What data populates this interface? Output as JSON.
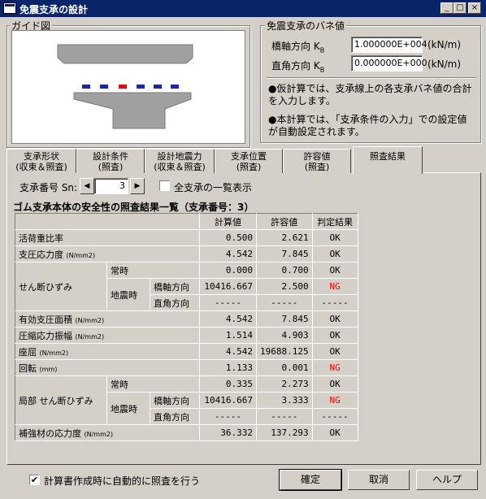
{
  "window": {
    "title": "免震支承の設計",
    "minimize": "_",
    "maximize": "□",
    "close": "×"
  },
  "guide": {
    "label": "ガイド図"
  },
  "spring": {
    "label": "免震支承のバネ値",
    "rows": [
      {
        "label": "橋軸方向 K",
        "sub": "B",
        "value": "1.000000E+004",
        "unit": "(kN/m)"
      },
      {
        "label": "直角方向 K",
        "sub": "B",
        "value": "0.000000E+000",
        "unit": "(kN/m)"
      }
    ],
    "notes": [
      "●仮計算では、支承線上の各支承バネ値の合計を入力します。",
      "●本計算では、「支承条件の入力」での設定値が自動設定されます。"
    ]
  },
  "tabs": [
    {
      "line1": "支承形状",
      "line2": "(収束＆照査)"
    },
    {
      "line1": "設計条件",
      "line2": "(照査)"
    },
    {
      "line1": "設計地震力",
      "line2": "(収束＆照査)"
    },
    {
      "line1": "支承位置",
      "line2": "(照査)"
    },
    {
      "line1": "許容値",
      "line2": "(照査)"
    },
    {
      "line1": "照査結果",
      "line2": ""
    }
  ],
  "selector": {
    "label": "支承番号 Sn:",
    "prev": "◀",
    "value": "3",
    "next": "▶",
    "all_checkbox_label": "全支承の一覧表示",
    "all_checked": false
  },
  "table": {
    "heading": "ゴム支承本体の安全性の照査結果一覧（支承番号：3）",
    "col_calc": "計算値",
    "col_allow": "許容値",
    "col_judge": "判定結果",
    "rows": {
      "live_ratio": {
        "label": "活荷重比率",
        "unit": "",
        "calc": "0.500",
        "allow": "2.621",
        "judge": "OK"
      },
      "bearing_stress": {
        "label": "支圧応力度",
        "unit": "(N/mm2)",
        "calc": "4.542",
        "allow": "7.845",
        "judge": "OK"
      },
      "shear": {
        "label": "せん断ひずみ",
        "normal": {
          "label": "常時",
          "calc": "0.000",
          "allow": "0.700",
          "judge": "OK"
        },
        "eq_label": "地震時",
        "eq_long": {
          "label": "橋軸方向",
          "calc": "10416.667",
          "allow": "2.500",
          "judge": "NG"
        },
        "eq_trans": {
          "label": "直角方向",
          "calc": "-----",
          "allow": "-----",
          "judge": "-----"
        }
      },
      "eff_area": {
        "label": "有効支圧面積",
        "unit": "(N/mm2)",
        "calc": "4.542",
        "allow": "7.845",
        "judge": "OK"
      },
      "comp_amp": {
        "label": "圧縮応力振幅",
        "unit": "(N/mm2)",
        "calc": "1.514",
        "allow": "4.903",
        "judge": "OK"
      },
      "buckling": {
        "label": "座屈",
        "unit": "(N/mm2)",
        "calc": "4.542",
        "allow": "19688.125",
        "judge": "OK"
      },
      "rotation": {
        "label": "回転",
        "unit": "(mm)",
        "calc": "1.133",
        "allow": "0.001",
        "judge": "NG"
      },
      "local_shear": {
        "label": "局部 せん断ひずみ",
        "normal": {
          "label": "常時",
          "calc": "0.335",
          "allow": "2.273",
          "judge": "OK"
        },
        "eq_label": "地震時",
        "eq_long": {
          "label": "橋軸方向",
          "calc": "10416.667",
          "allow": "3.333",
          "judge": "NG"
        },
        "eq_trans": {
          "label": "直角方向",
          "calc": "-----",
          "allow": "-----",
          "judge": "-----"
        }
      },
      "reinforce": {
        "label": "補強材の応力度",
        "unit": "(N/mm2)",
        "calc": "36.332",
        "allow": "137.293",
        "judge": "OK"
      }
    }
  },
  "footer": {
    "auto_check_label": "計算書作成時に自動的に照査を行う",
    "auto_checked": true,
    "ok": "確定",
    "cancel": "取消",
    "help": "ヘルプ"
  },
  "colors": {
    "titlebar": "#0a246a",
    "ng": "#ff0000",
    "pad_red": "#d01010",
    "pad_blue": "#1a2a9a"
  }
}
